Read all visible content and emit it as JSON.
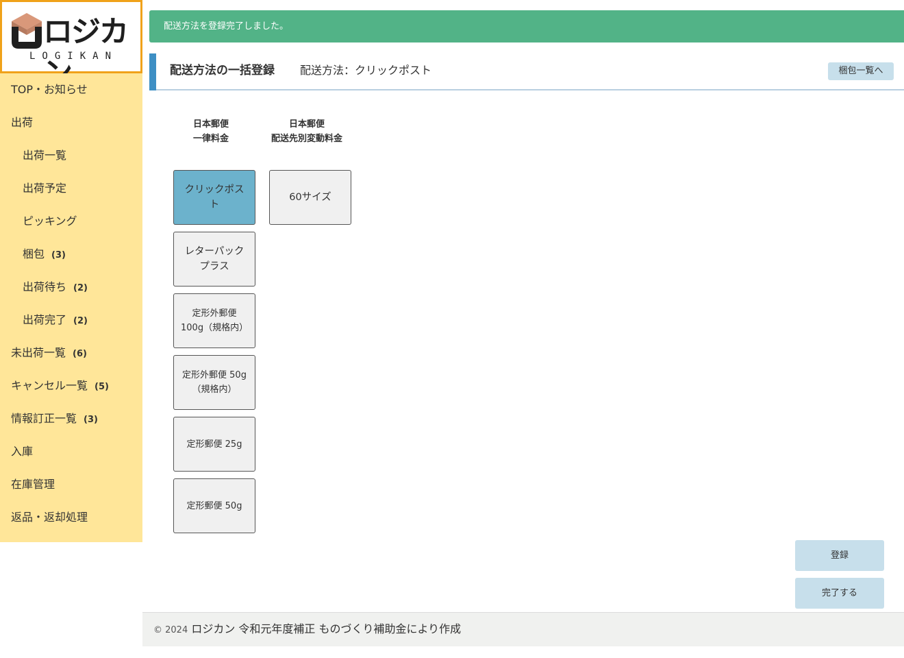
{
  "logo": {
    "brand": "ロジカン",
    "brand_sub": "LOGIKAN"
  },
  "sidebar": {
    "items": [
      {
        "label": "TOP・お知らせ",
        "count": ""
      },
      {
        "label": "出荷",
        "count": ""
      },
      {
        "label": "出荷一覧",
        "count": ""
      },
      {
        "label": "出荷予定",
        "count": ""
      },
      {
        "label": "ピッキング",
        "count": ""
      },
      {
        "label": "梱包",
        "count": "(3)"
      },
      {
        "label": "出荷待ち",
        "count": "(2)"
      },
      {
        "label": "出荷完了",
        "count": "(2)"
      },
      {
        "label": "未出荷一覧",
        "count": "(6)"
      },
      {
        "label": "キャンセル一覧",
        "count": "(5)"
      },
      {
        "label": "情報訂正一覧",
        "count": "(3)"
      },
      {
        "label": "入庫",
        "count": ""
      },
      {
        "label": "在庫管理",
        "count": ""
      },
      {
        "label": "返品・返却処理",
        "count": ""
      }
    ]
  },
  "alert": {
    "message": "配送方法を登録完了しました。"
  },
  "header": {
    "title": "配送方法の一括登録",
    "subtitle": "配送方法：クリックポスト",
    "back_button": "梱包一覧へ"
  },
  "columns": [
    {
      "heading": "日本郵便\n一律料金",
      "methods": [
        {
          "label": "クリックポスト",
          "selected": true
        },
        {
          "label": "レターパックプラス",
          "selected": false
        },
        {
          "label": "定形外郵便 100g（規格内）",
          "selected": false
        },
        {
          "label": "定形外郵便 50g（規格内）",
          "selected": false
        },
        {
          "label": "定形郵便 25g",
          "selected": false
        },
        {
          "label": "定形郵便 50g",
          "selected": false
        }
      ]
    },
    {
      "heading": "日本郵便\n配送先別変動料金",
      "methods": [
        {
          "label": "60サイズ",
          "selected": false
        }
      ]
    }
  ],
  "actions": {
    "register": "登録",
    "complete": "完了する"
  },
  "footer": {
    "copyright": "© 2024",
    "text": "ロジカン 令和元年度補正 ものづくり補助金により作成"
  },
  "colors": {
    "sidebar_bg": "#ffe699",
    "logo_border": "#f0a21a",
    "alert_bg": "#52b387",
    "header_accent": "#3e8fc4",
    "selected_method": "#6cb2cc",
    "action_button": "#c7dfeb"
  }
}
